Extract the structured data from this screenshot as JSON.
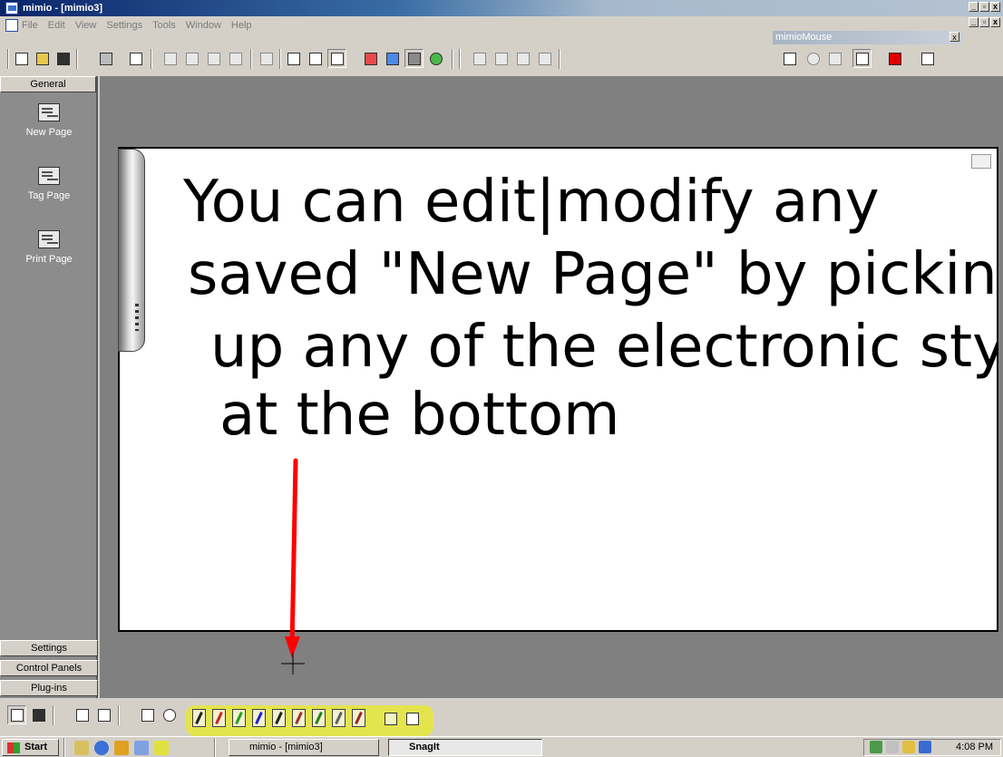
{
  "window": {
    "title": "mimio - [mimio3]"
  },
  "menu": {
    "items": [
      "File",
      "Edit",
      "View",
      "Settings",
      "Tools",
      "Window",
      "Help"
    ]
  },
  "mimiomouse": {
    "title": "mimioMouse"
  },
  "sidebar": {
    "top_tab": "General",
    "buttons": [
      {
        "label": "New Page",
        "icon": "new-page-icon"
      },
      {
        "label": "Tag Page",
        "icon": "tag-page-icon"
      },
      {
        "label": "Print Page",
        "icon": "printer-icon"
      }
    ],
    "bottom_tabs": [
      "Settings",
      "Control Panels",
      "Plug-ins"
    ]
  },
  "page": {
    "handwriting_lines": [
      "You can edit|modify any",
      "saved \"New Page\" by picking",
      "up any of the electronic styli",
      "at the bottom"
    ],
    "annotation_color": "#ff0000"
  },
  "pens": {
    "colors": [
      "#202020",
      "#d02020",
      "#20a020",
      "#2020d0",
      "#202020",
      "#a03030",
      "#208020",
      "#606060",
      "#a02020"
    ],
    "highlight_color": "#e6e83a"
  },
  "taskbar": {
    "start_label": "Start",
    "tasks": [
      {
        "label": "mimio - [mimio3]",
        "active": false
      },
      {
        "label": "SnagIt",
        "active": true
      }
    ],
    "clock": "4:08 PM"
  }
}
